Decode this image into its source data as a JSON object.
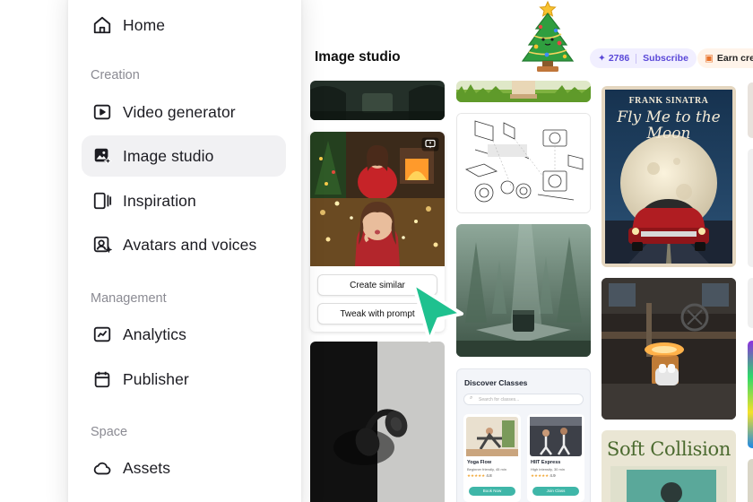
{
  "sidebar": {
    "items": [
      {
        "label": "Home",
        "icon": "home-icon"
      },
      {
        "label": "Video generator",
        "icon": "video-generator-icon"
      },
      {
        "label": "Image studio",
        "icon": "image-studio-icon",
        "active": true
      },
      {
        "label": "Inspiration",
        "icon": "inspiration-icon"
      },
      {
        "label": "Avatars and voices",
        "icon": "avatar-icon"
      },
      {
        "label": "Analytics",
        "icon": "analytics-icon"
      },
      {
        "label": "Publisher",
        "icon": "calendar-icon"
      },
      {
        "label": "Assets",
        "icon": "cloud-icon"
      }
    ],
    "sections": {
      "creation": "Creation",
      "management": "Management",
      "space": "Space"
    }
  },
  "header": {
    "title": "Image studio",
    "credits": "2786",
    "subscribe": "Subscribe",
    "earn": "Earn cred"
  },
  "hover_card": {
    "create_similar": "Create similar",
    "tweak_prompt": "Tweak with prompt"
  },
  "poster": {
    "artist": "FRANK SINATRA",
    "title": "Fly Me to the Moon"
  },
  "discover": {
    "title": "Discover Classes",
    "search_placeholder": "Search for classes...",
    "classes": [
      {
        "name": "Yoga Flow",
        "desc": "Beginner friendly, 45 min",
        "rating": "4.8",
        "button": "Book Now"
      },
      {
        "name": "HIIT Express",
        "desc": "High intensity, 30 min",
        "rating": "4.9",
        "button": "Join Class"
      }
    ]
  },
  "soft_collision": {
    "title": "Soft Collision"
  },
  "colors": {
    "accent": "#5a48d8",
    "cursor": "#1fc18f",
    "active_bg": "#f1f1f3"
  }
}
